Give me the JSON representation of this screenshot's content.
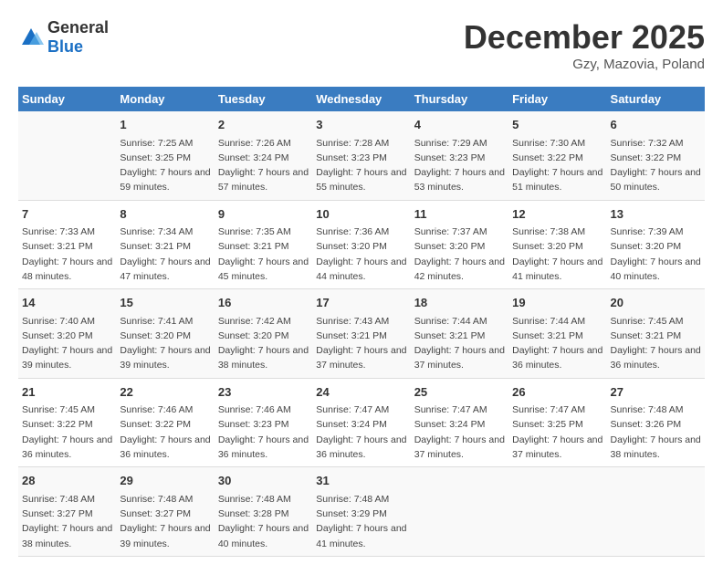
{
  "logo": {
    "text_general": "General",
    "text_blue": "Blue"
  },
  "header": {
    "month_title": "December 2025",
    "subtitle": "Gzy, Mazovia, Poland"
  },
  "days_of_week": [
    "Sunday",
    "Monday",
    "Tuesday",
    "Wednesday",
    "Thursday",
    "Friday",
    "Saturday"
  ],
  "weeks": [
    [
      {
        "day": "",
        "sunrise": "",
        "sunset": "",
        "daylight": ""
      },
      {
        "day": "1",
        "sunrise": "Sunrise: 7:25 AM",
        "sunset": "Sunset: 3:25 PM",
        "daylight": "Daylight: 7 hours and 59 minutes."
      },
      {
        "day": "2",
        "sunrise": "Sunrise: 7:26 AM",
        "sunset": "Sunset: 3:24 PM",
        "daylight": "Daylight: 7 hours and 57 minutes."
      },
      {
        "day": "3",
        "sunrise": "Sunrise: 7:28 AM",
        "sunset": "Sunset: 3:23 PM",
        "daylight": "Daylight: 7 hours and 55 minutes."
      },
      {
        "day": "4",
        "sunrise": "Sunrise: 7:29 AM",
        "sunset": "Sunset: 3:23 PM",
        "daylight": "Daylight: 7 hours and 53 minutes."
      },
      {
        "day": "5",
        "sunrise": "Sunrise: 7:30 AM",
        "sunset": "Sunset: 3:22 PM",
        "daylight": "Daylight: 7 hours and 51 minutes."
      },
      {
        "day": "6",
        "sunrise": "Sunrise: 7:32 AM",
        "sunset": "Sunset: 3:22 PM",
        "daylight": "Daylight: 7 hours and 50 minutes."
      }
    ],
    [
      {
        "day": "7",
        "sunrise": "Sunrise: 7:33 AM",
        "sunset": "Sunset: 3:21 PM",
        "daylight": "Daylight: 7 hours and 48 minutes."
      },
      {
        "day": "8",
        "sunrise": "Sunrise: 7:34 AM",
        "sunset": "Sunset: 3:21 PM",
        "daylight": "Daylight: 7 hours and 47 minutes."
      },
      {
        "day": "9",
        "sunrise": "Sunrise: 7:35 AM",
        "sunset": "Sunset: 3:21 PM",
        "daylight": "Daylight: 7 hours and 45 minutes."
      },
      {
        "day": "10",
        "sunrise": "Sunrise: 7:36 AM",
        "sunset": "Sunset: 3:20 PM",
        "daylight": "Daylight: 7 hours and 44 minutes."
      },
      {
        "day": "11",
        "sunrise": "Sunrise: 7:37 AM",
        "sunset": "Sunset: 3:20 PM",
        "daylight": "Daylight: 7 hours and 42 minutes."
      },
      {
        "day": "12",
        "sunrise": "Sunrise: 7:38 AM",
        "sunset": "Sunset: 3:20 PM",
        "daylight": "Daylight: 7 hours and 41 minutes."
      },
      {
        "day": "13",
        "sunrise": "Sunrise: 7:39 AM",
        "sunset": "Sunset: 3:20 PM",
        "daylight": "Daylight: 7 hours and 40 minutes."
      }
    ],
    [
      {
        "day": "14",
        "sunrise": "Sunrise: 7:40 AM",
        "sunset": "Sunset: 3:20 PM",
        "daylight": "Daylight: 7 hours and 39 minutes."
      },
      {
        "day": "15",
        "sunrise": "Sunrise: 7:41 AM",
        "sunset": "Sunset: 3:20 PM",
        "daylight": "Daylight: 7 hours and 39 minutes."
      },
      {
        "day": "16",
        "sunrise": "Sunrise: 7:42 AM",
        "sunset": "Sunset: 3:20 PM",
        "daylight": "Daylight: 7 hours and 38 minutes."
      },
      {
        "day": "17",
        "sunrise": "Sunrise: 7:43 AM",
        "sunset": "Sunset: 3:21 PM",
        "daylight": "Daylight: 7 hours and 37 minutes."
      },
      {
        "day": "18",
        "sunrise": "Sunrise: 7:44 AM",
        "sunset": "Sunset: 3:21 PM",
        "daylight": "Daylight: 7 hours and 37 minutes."
      },
      {
        "day": "19",
        "sunrise": "Sunrise: 7:44 AM",
        "sunset": "Sunset: 3:21 PM",
        "daylight": "Daylight: 7 hours and 36 minutes."
      },
      {
        "day": "20",
        "sunrise": "Sunrise: 7:45 AM",
        "sunset": "Sunset: 3:21 PM",
        "daylight": "Daylight: 7 hours and 36 minutes."
      }
    ],
    [
      {
        "day": "21",
        "sunrise": "Sunrise: 7:45 AM",
        "sunset": "Sunset: 3:22 PM",
        "daylight": "Daylight: 7 hours and 36 minutes."
      },
      {
        "day": "22",
        "sunrise": "Sunrise: 7:46 AM",
        "sunset": "Sunset: 3:22 PM",
        "daylight": "Daylight: 7 hours and 36 minutes."
      },
      {
        "day": "23",
        "sunrise": "Sunrise: 7:46 AM",
        "sunset": "Sunset: 3:23 PM",
        "daylight": "Daylight: 7 hours and 36 minutes."
      },
      {
        "day": "24",
        "sunrise": "Sunrise: 7:47 AM",
        "sunset": "Sunset: 3:24 PM",
        "daylight": "Daylight: 7 hours and 36 minutes."
      },
      {
        "day": "25",
        "sunrise": "Sunrise: 7:47 AM",
        "sunset": "Sunset: 3:24 PM",
        "daylight": "Daylight: 7 hours and 37 minutes."
      },
      {
        "day": "26",
        "sunrise": "Sunrise: 7:47 AM",
        "sunset": "Sunset: 3:25 PM",
        "daylight": "Daylight: 7 hours and 37 minutes."
      },
      {
        "day": "27",
        "sunrise": "Sunrise: 7:48 AM",
        "sunset": "Sunset: 3:26 PM",
        "daylight": "Daylight: 7 hours and 38 minutes."
      }
    ],
    [
      {
        "day": "28",
        "sunrise": "Sunrise: 7:48 AM",
        "sunset": "Sunset: 3:27 PM",
        "daylight": "Daylight: 7 hours and 38 minutes."
      },
      {
        "day": "29",
        "sunrise": "Sunrise: 7:48 AM",
        "sunset": "Sunset: 3:27 PM",
        "daylight": "Daylight: 7 hours and 39 minutes."
      },
      {
        "day": "30",
        "sunrise": "Sunrise: 7:48 AM",
        "sunset": "Sunset: 3:28 PM",
        "daylight": "Daylight: 7 hours and 40 minutes."
      },
      {
        "day": "31",
        "sunrise": "Sunrise: 7:48 AM",
        "sunset": "Sunset: 3:29 PM",
        "daylight": "Daylight: 7 hours and 41 minutes."
      },
      {
        "day": "",
        "sunrise": "",
        "sunset": "",
        "daylight": ""
      },
      {
        "day": "",
        "sunrise": "",
        "sunset": "",
        "daylight": ""
      },
      {
        "day": "",
        "sunrise": "",
        "sunset": "",
        "daylight": ""
      }
    ]
  ]
}
